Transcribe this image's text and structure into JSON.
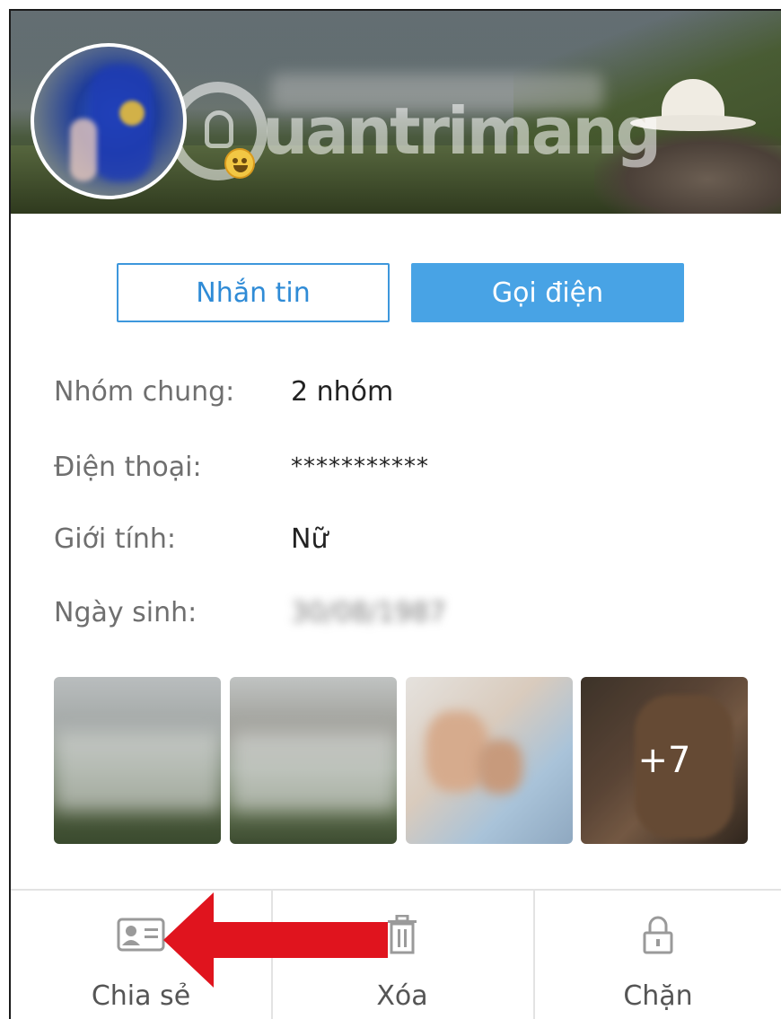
{
  "profile": {
    "watermark_text": "uantrimang"
  },
  "actions": {
    "message_label": "Nhắn tin",
    "call_label": "Gọi điện"
  },
  "info": [
    {
      "label": "Nhóm chung:",
      "value": "2 nhóm"
    },
    {
      "label": "Điện thoại:",
      "value": "***********"
    },
    {
      "label": "Giới tính:",
      "value": "Nữ"
    },
    {
      "label": "Ngày sinh:",
      "value": "30/08/1987"
    }
  ],
  "photos": {
    "more_count": "+7"
  },
  "bottom_bar": {
    "share_label": "Chia sẻ",
    "delete_label": "Xóa",
    "block_label": "Chặn"
  },
  "colors": {
    "accent": "#48a3e5",
    "annotation_arrow": "#e0141e"
  },
  "icons": [
    "contact-card-icon",
    "trash-icon",
    "lock-icon"
  ]
}
